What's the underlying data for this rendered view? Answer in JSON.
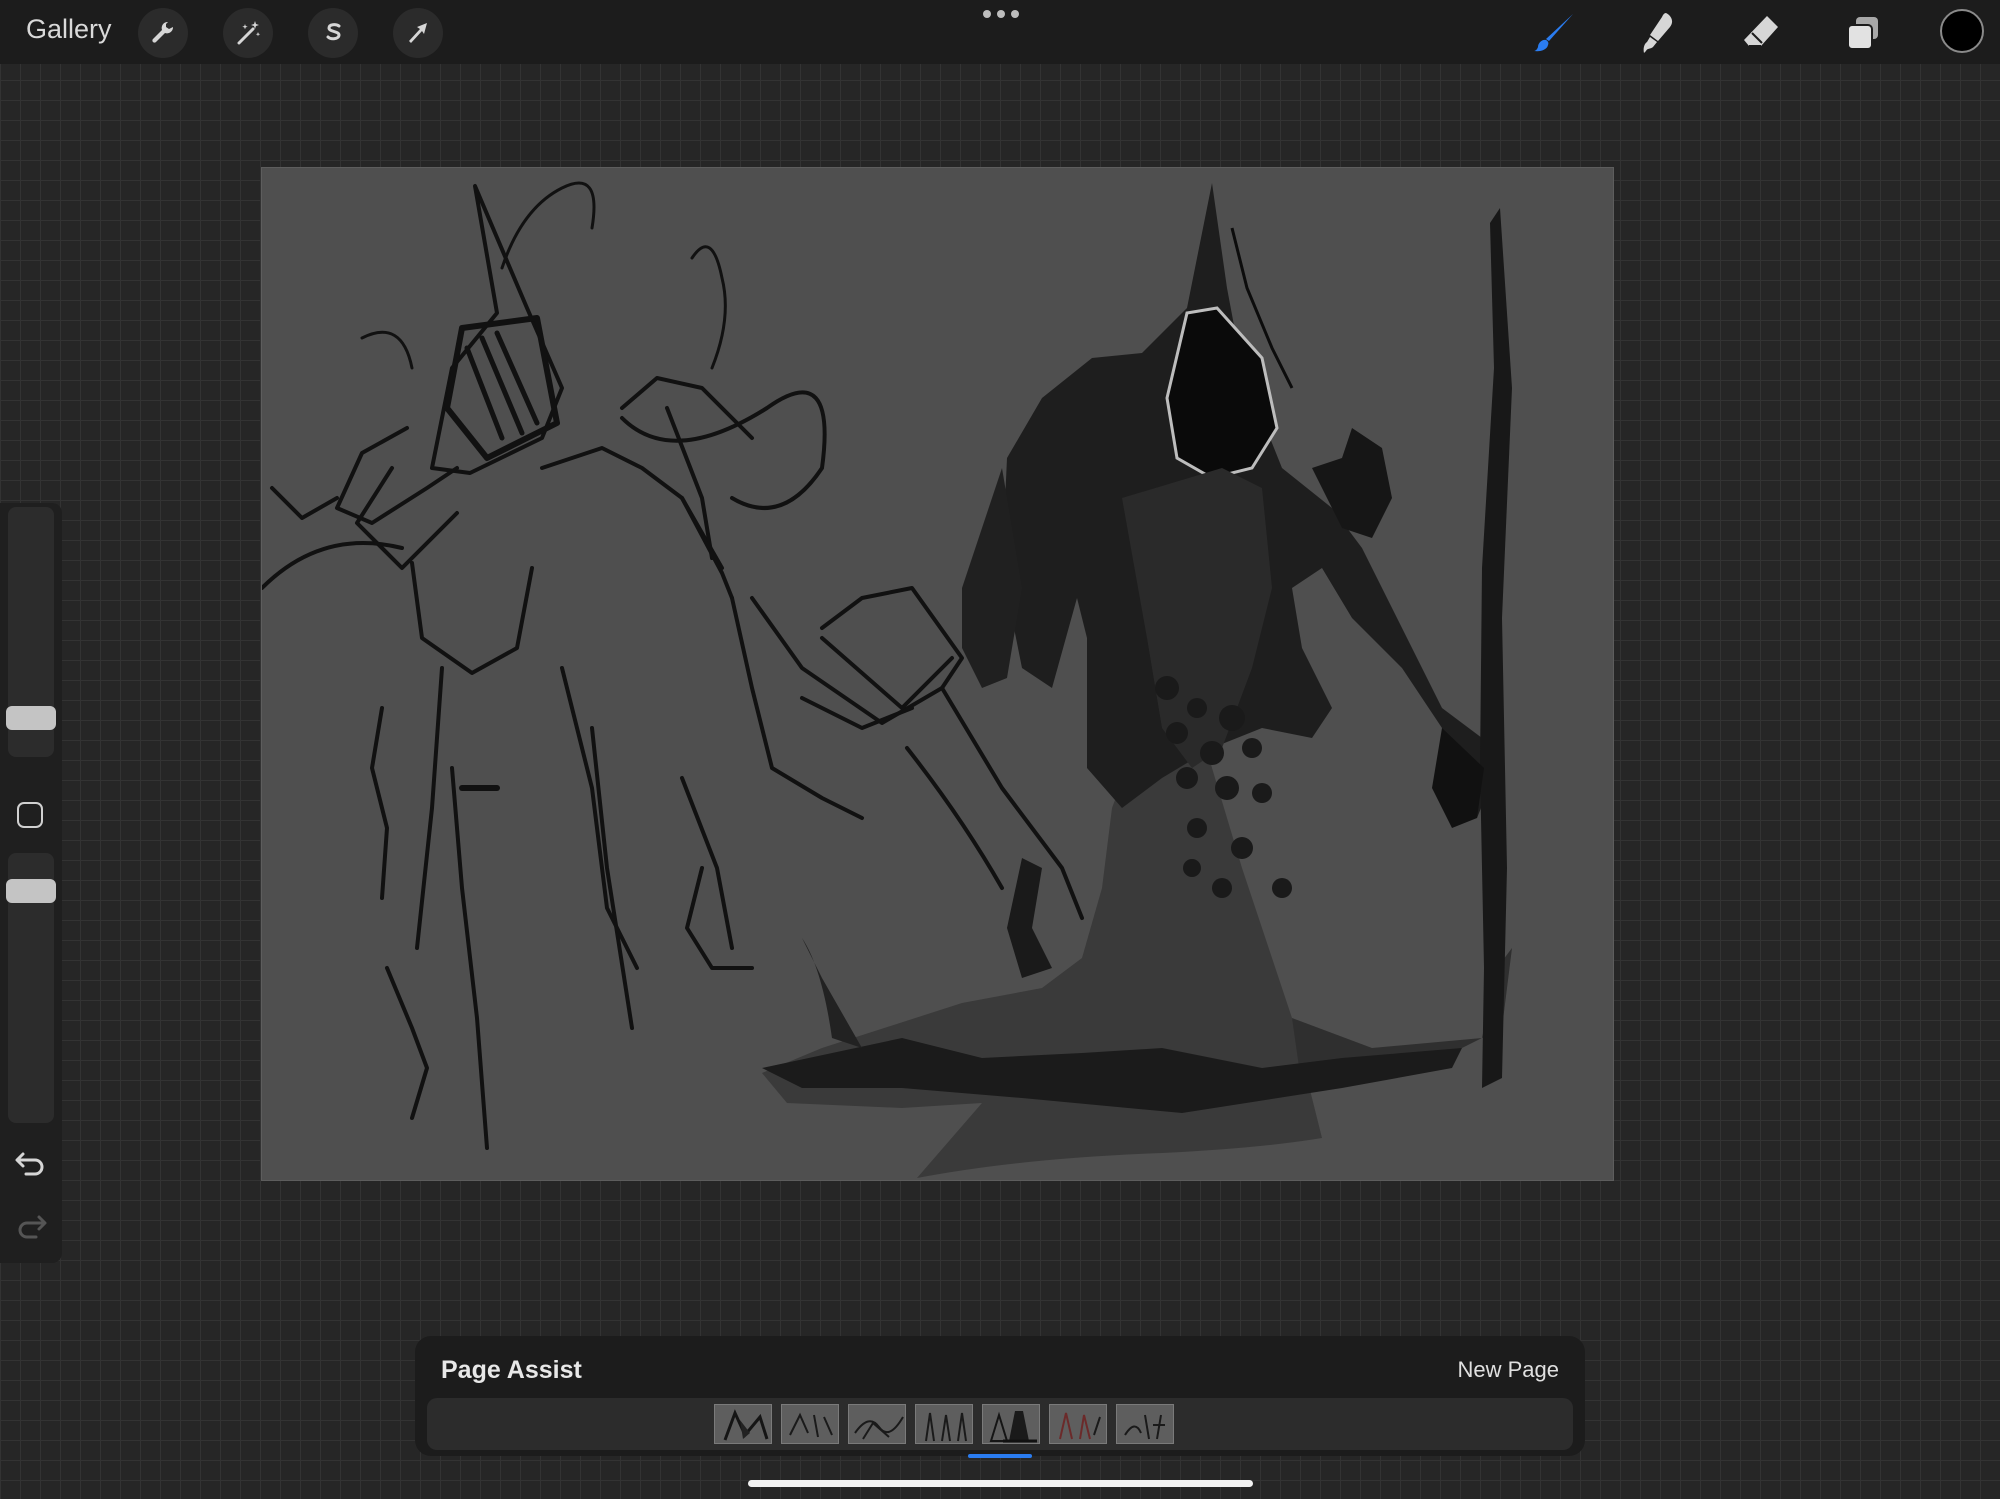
{
  "toolbar": {
    "gallery_label": "Gallery",
    "left_tools": [
      "wrench-icon",
      "magic-wand-icon",
      "selection-s-icon",
      "transform-arrow-icon"
    ],
    "right_tools": [
      "brush-icon",
      "smudge-icon",
      "eraser-icon",
      "layers-icon"
    ],
    "active_tool": "brush-icon",
    "active_color": "#000000",
    "accent_color": "#2a7cf0"
  },
  "sidebar": {
    "brush_size_level": 0.12,
    "opacity_level": 0.95,
    "items": [
      "brush-size-slider",
      "modify-button",
      "opacity-slider",
      "undo-icon",
      "redo-icon"
    ]
  },
  "canvas": {
    "background": "#4f4f4f",
    "content": "two dark sketches of a hooded, pointed-hat figure"
  },
  "page_assist": {
    "title": "Page Assist",
    "new_page_label": "New Page",
    "page_count": 7,
    "active_page": 5
  }
}
